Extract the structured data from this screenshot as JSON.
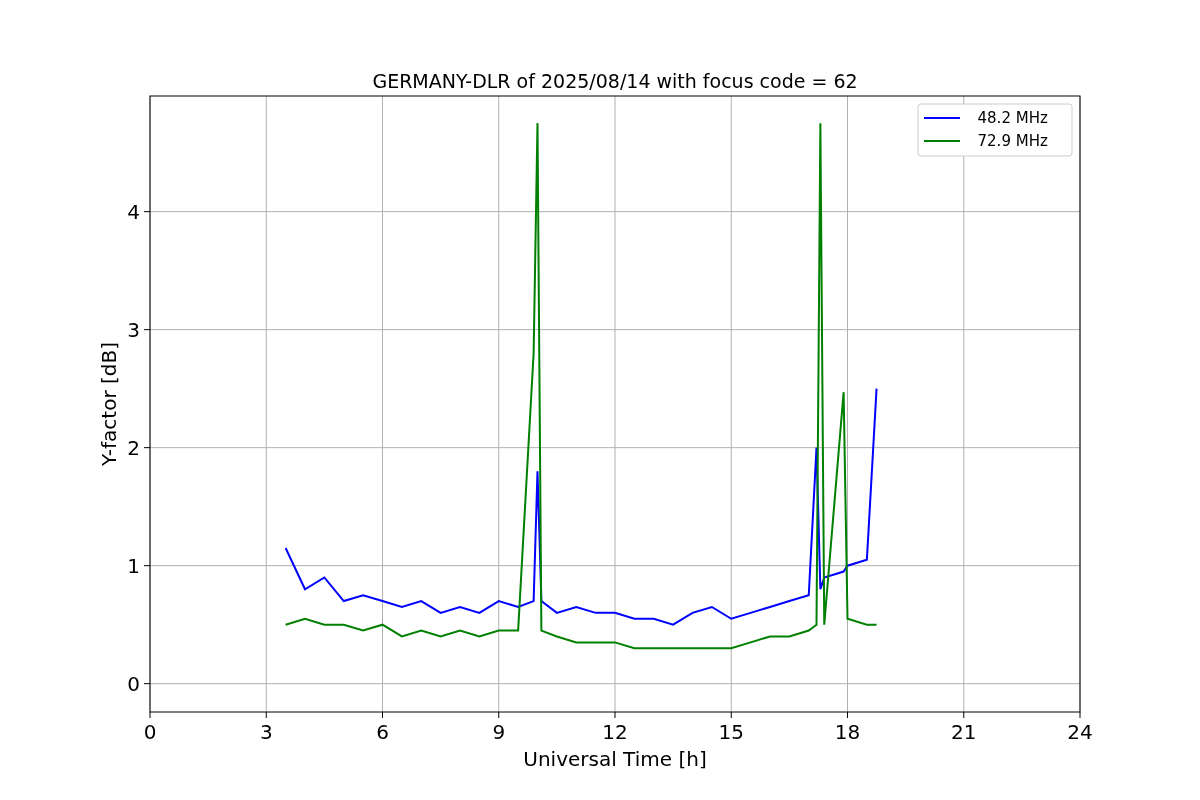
{
  "figure": {
    "chart_data": {
      "type": "line",
      "title": "GERMANY-DLR of 2025/08/14 with focus code = 62",
      "xlabel": "Universal Time [h]",
      "ylabel": "Y-factor [dB]",
      "xlim": [
        0,
        24
      ],
      "ylim": [
        -0.24,
        4.98
      ],
      "xticks": [
        0,
        3,
        6,
        9,
        12,
        15,
        18,
        21,
        24
      ],
      "yticks": [
        0,
        1,
        2,
        3,
        4
      ],
      "grid": true,
      "legend": true,
      "x": [
        3.5,
        4,
        4.5,
        5,
        5.5,
        6,
        6.5,
        7,
        7.5,
        8,
        8.5,
        9,
        9.5,
        9.9,
        10,
        10.1,
        10.5,
        11,
        11.5,
        12,
        12.5,
        13,
        13.5,
        14,
        14.5,
        15,
        15.5,
        16,
        16.5,
        17,
        17.2,
        17.3,
        17.4,
        17.9,
        18,
        18.5,
        18.75
      ],
      "series": [
        {
          "name": "  48.2 MHz",
          "color": "#0000ff",
          "values": [
            1.15,
            0.8,
            0.9,
            0.7,
            0.75,
            0.7,
            0.65,
            0.7,
            0.6,
            0.65,
            0.6,
            0.7,
            0.65,
            0.7,
            1.8,
            0.7,
            0.6,
            0.65,
            0.6,
            0.6,
            0.55,
            0.55,
            0.5,
            0.6,
            0.65,
            0.55,
            0.6,
            0.65,
            0.7,
            0.75,
            2.0,
            0.8,
            0.9,
            0.95,
            1.0,
            1.05,
            2.5
          ]
        },
        {
          "name": "  72.9 MHz",
          "color": "#008000",
          "values": [
            0.5,
            0.55,
            0.5,
            0.5,
            0.45,
            0.5,
            0.4,
            0.45,
            0.4,
            0.45,
            0.4,
            0.45,
            0.45,
            2.8,
            4.75,
            0.45,
            0.4,
            0.35,
            0.35,
            0.35,
            0.3,
            0.3,
            0.3,
            0.3,
            0.3,
            0.3,
            0.35,
            0.4,
            0.4,
            0.45,
            0.5,
            4.75,
            0.5,
            2.47,
            0.55,
            0.5,
            0.5
          ]
        }
      ]
    }
  }
}
